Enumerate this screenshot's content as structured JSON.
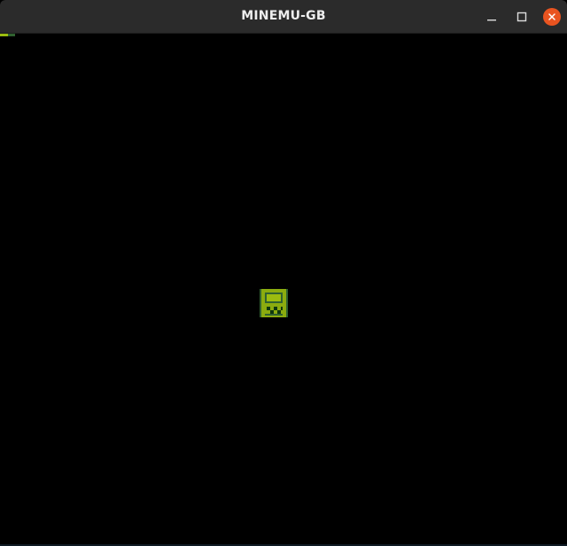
{
  "window": {
    "title": "MINEMU-GB"
  },
  "titlebar": {
    "controls": [
      {
        "name": "minimize",
        "icon": "minimize-icon"
      },
      {
        "name": "maximize",
        "icon": "maximize-icon"
      },
      {
        "name": "close",
        "icon": "close-icon"
      }
    ]
  },
  "screen": {
    "background": "#000000",
    "logo_icon": "gameboy-icon",
    "palette": {
      "lightest": "#9bbc0f",
      "light": "#8bac0f",
      "dark": "#306230",
      "darkest": "#0f380f"
    },
    "close_accent": "#e95420"
  }
}
